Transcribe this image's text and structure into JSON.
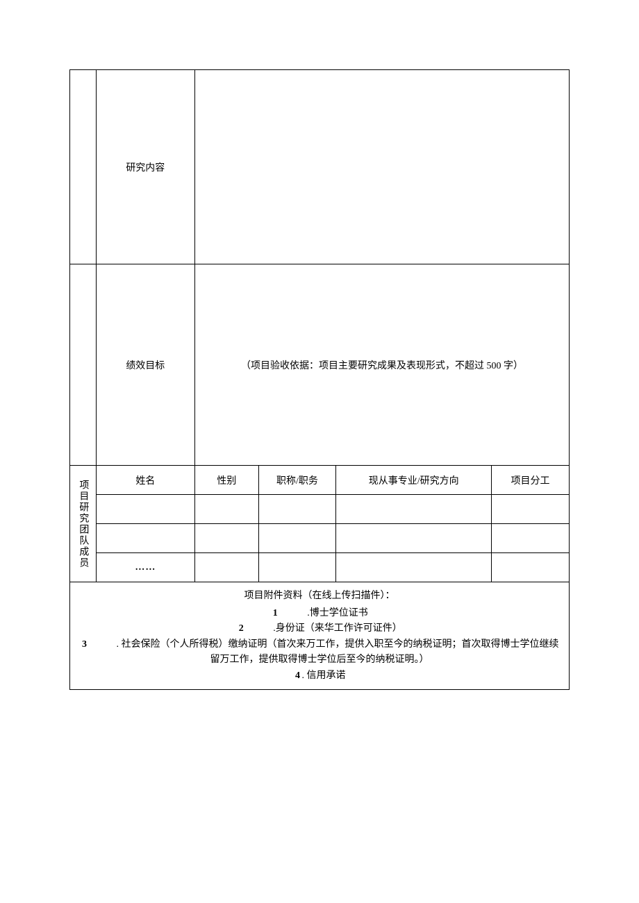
{
  "section1": {
    "row1_label": "研究内容",
    "row2_label": "绩效目标",
    "row2_note": "（项目验收依据：项目主要研究成果及表现形式，不超过 500 字）"
  },
  "section2": {
    "group_label": "项目研究团队成员",
    "headers": {
      "name": "姓名",
      "gender": "性别",
      "title": "职称/职务",
      "field": "现从事专业/研究方向",
      "role": "项目分工"
    },
    "rows": [
      {
        "name": "",
        "gender": "",
        "title": "",
        "field": "",
        "role": ""
      },
      {
        "name": "",
        "gender": "",
        "title": "",
        "field": "",
        "role": ""
      },
      {
        "name": "……",
        "gender": "",
        "title": "",
        "field": "",
        "role": ""
      }
    ]
  },
  "attachments": {
    "title": "项目附件资料（在线上传扫描件）：",
    "items": [
      {
        "num": "1",
        "text": ".博士学位证书"
      },
      {
        "num": "2",
        "text": ".身份证（来华工作许可证件）"
      },
      {
        "num": "3",
        "text": ". 社会保险（个人所得税）缴纳证明（首次来万工作，提供入职至今的纳税证明；首次取得博士学位继续留万工作，提供取得博士学位后至今的纳税证明。）"
      },
      {
        "num": "4",
        "text": ". 信用承诺"
      }
    ]
  }
}
